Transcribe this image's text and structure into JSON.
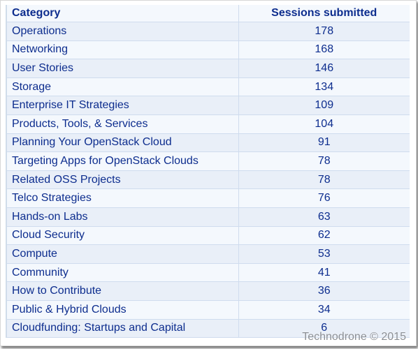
{
  "table": {
    "headers": [
      "Category",
      "Sessions submitted"
    ],
    "rows": [
      {
        "category": "Operations",
        "sessions": "178"
      },
      {
        "category": "Networking",
        "sessions": "168"
      },
      {
        "category": "User Stories",
        "sessions": "146"
      },
      {
        "category": "Storage",
        "sessions": "134"
      },
      {
        "category": "Enterprise IT Strategies",
        "sessions": "109"
      },
      {
        "category": "Products, Tools, & Services",
        "sessions": "104"
      },
      {
        "category": "Planning Your OpenStack Cloud",
        "sessions": "91"
      },
      {
        "category": "Targeting Apps for OpenStack Clouds",
        "sessions": "78"
      },
      {
        "category": "Related OSS Projects",
        "sessions": "78"
      },
      {
        "category": "Telco Strategies",
        "sessions": "76"
      },
      {
        "category": "Hands-on Labs",
        "sessions": "63"
      },
      {
        "category": "Cloud Security",
        "sessions": "62"
      },
      {
        "category": "Compute",
        "sessions": "53"
      },
      {
        "category": "Community",
        "sessions": "41"
      },
      {
        "category": "How to Contribute",
        "sessions": "36"
      },
      {
        "category": "Public & Hybrid Clouds",
        "sessions": "34"
      },
      {
        "category": "Cloudfunding: Startups and Capital",
        "sessions": "6"
      }
    ]
  },
  "watermark": "Technodrone © 2015",
  "colors": {
    "text": "#0d2d8e",
    "row_odd": "#e9eff8",
    "row_even": "#f4f8fd",
    "grid": "#cfdcee"
  }
}
